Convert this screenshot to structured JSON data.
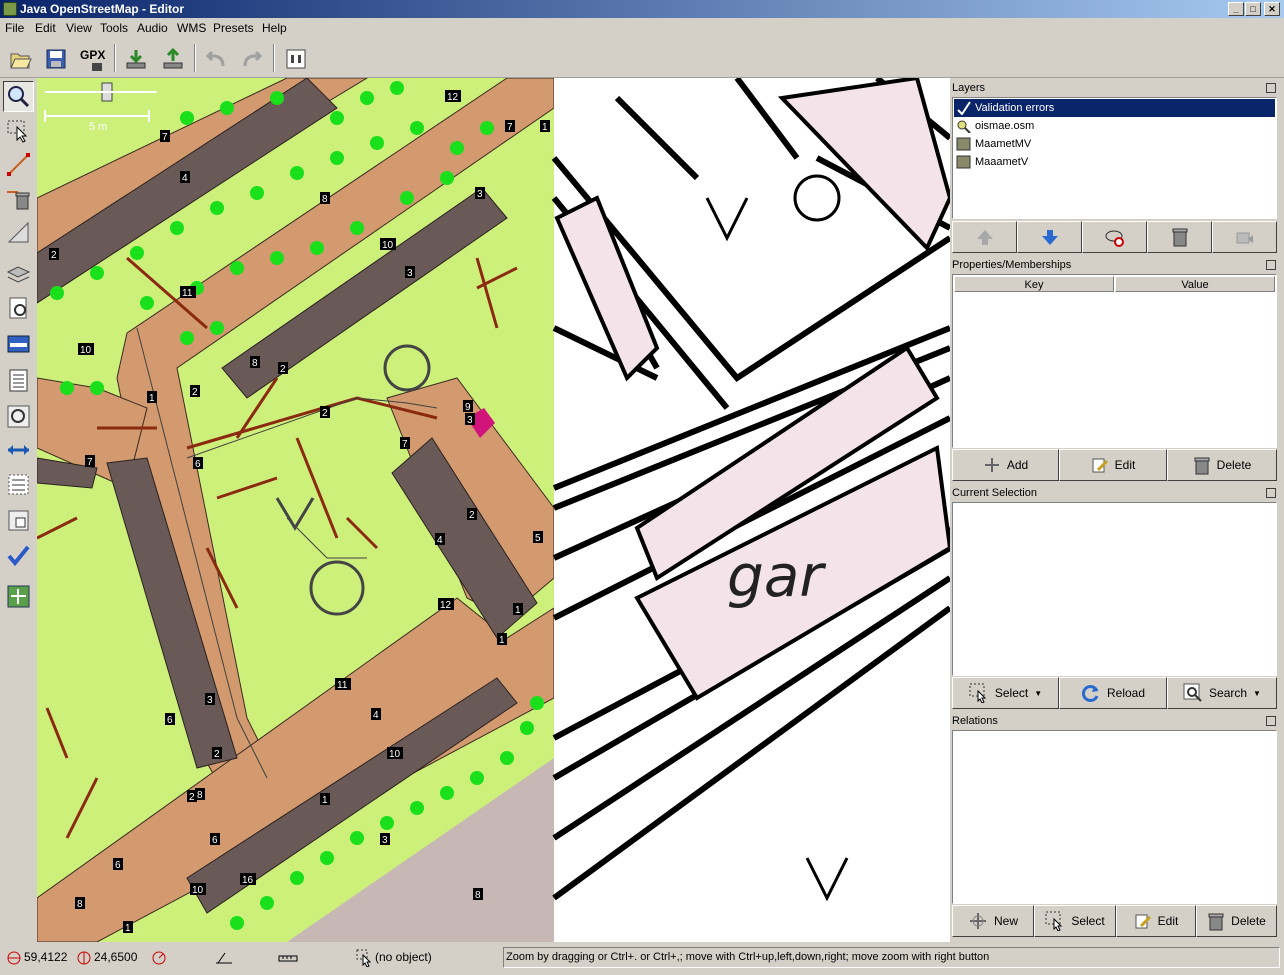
{
  "window": {
    "title": "Java OpenStreetMap - Editor",
    "controls": {
      "minimize": "_",
      "maximize": "□",
      "close": "✕"
    }
  },
  "menu": [
    "File",
    "Edit",
    "View",
    "Tools",
    "Audio",
    "WMS",
    "Presets",
    "Help"
  ],
  "toolbar": {
    "gpx_label": "GPX",
    "buttons": [
      "open-icon",
      "save-icon",
      "export-gpx-icon",
      "download-icon",
      "upload-icon",
      "undo-icon",
      "redo-icon",
      "preferences-icon"
    ]
  },
  "left_tools": [
    "zoom-icon",
    "select-icon",
    "draw-line-icon",
    "delete-icon",
    "measure-icon",
    "layers-toggle-icon",
    "properties-toggle-icon",
    "selection-list-icon",
    "history-icon",
    "conflict-icon",
    "relation-icon",
    "merge-icon",
    "search-icon",
    "validation-icon",
    "fullscreen-icon"
  ],
  "map": {
    "scale_label": "5 m",
    "street_label": "gar",
    "way_labels": [
      "12",
      "7",
      "4",
      "8",
      "3",
      "7",
      "2",
      "11",
      "8",
      "10",
      "3",
      "2",
      "10",
      "1",
      "2",
      "7",
      "6",
      "3",
      "2",
      "5",
      "4",
      "1",
      "11",
      "6",
      "3",
      "2",
      "12",
      "1",
      "4",
      "10",
      "2",
      "1",
      "8",
      "6",
      "8",
      "6",
      "10",
      "16",
      "3",
      "9",
      "8",
      "1",
      "1",
      "2",
      "7"
    ]
  },
  "layers_panel": {
    "title": "Layers",
    "layers": [
      {
        "name": "Validation errors",
        "icon": "validation-icon",
        "selected": true
      },
      {
        "name": "oismae.osm",
        "icon": "data-layer-icon",
        "selected": false
      },
      {
        "name": "MaametMV",
        "icon": "wms-layer-icon",
        "selected": false
      },
      {
        "name": "MaaametV",
        "icon": "wms-layer-icon",
        "selected": false
      }
    ],
    "buttons": [
      "move-up-icon",
      "move-down-icon",
      "toggle-visible-icon",
      "delete-layer-icon",
      "merge-layer-icon"
    ]
  },
  "properties_panel": {
    "title": "Properties/Memberships",
    "columns": [
      "Key",
      "Value"
    ],
    "buttons": [
      "Add",
      "Edit",
      "Delete"
    ]
  },
  "selection_panel": {
    "title": "Current Selection",
    "buttons": [
      "Select",
      "Reload",
      "Search"
    ]
  },
  "relations_panel": {
    "title": "Relations",
    "buttons": [
      "New",
      "Select",
      "Edit",
      "Delete"
    ]
  },
  "status": {
    "latitude": "59,4122",
    "longitude": "24,6500",
    "object": "(no object)",
    "help": "Zoom by dragging or Ctrl+. or Ctrl+,; move with Ctrl+up,left,down,right; move zoom with right button"
  },
  "colors": {
    "title_start": "#0a246a",
    "title_end": "#a6caf0",
    "selection": "#0a246a",
    "map_green": "#ccf07a",
    "map_building": "#6a5a57",
    "map_road": "#d29a6e",
    "map_tree": "#19e01a",
    "map_path": "#8b2a10",
    "wms_highlight": "#f4e4ea"
  }
}
